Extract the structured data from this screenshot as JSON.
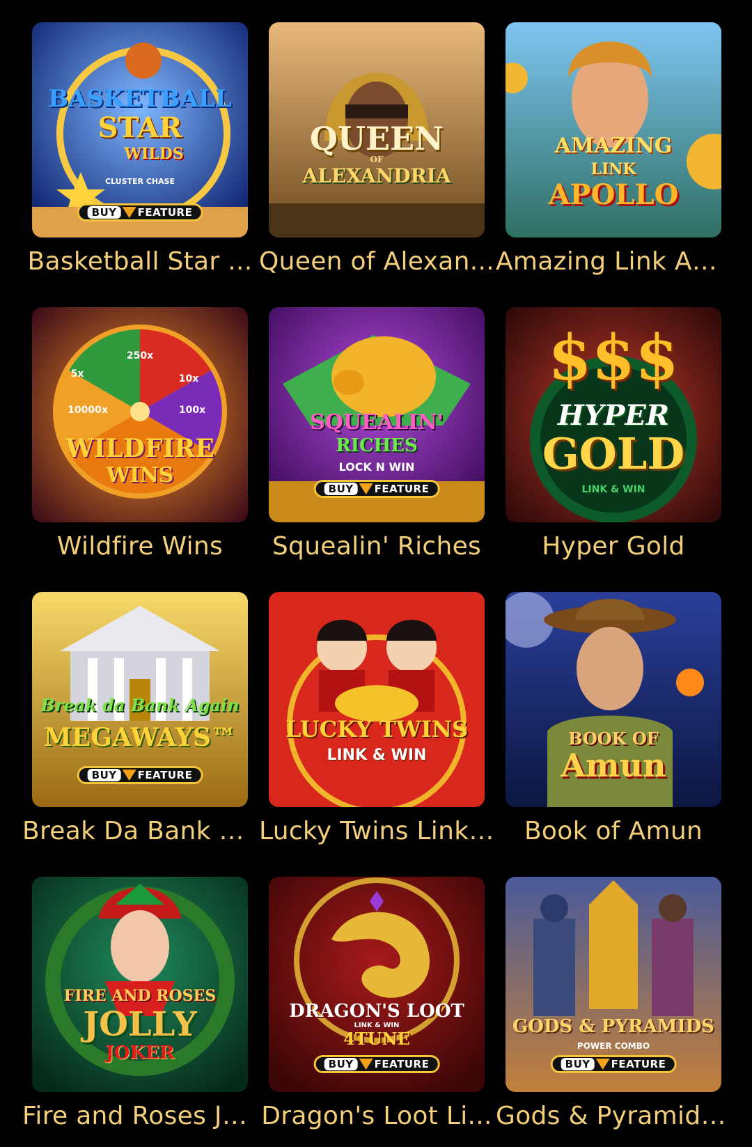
{
  "games": [
    {
      "title": "Basketball Star ...",
      "logo_lines": [
        "BASKETBALL",
        "STAR",
        "WILDS"
      ],
      "sub_text": "CLUSTER CHASE",
      "buy_feature": true
    },
    {
      "title": "Queen of Alexan...",
      "logo_lines": [
        "QUEEN",
        "OF",
        "ALEXANDRIA"
      ],
      "buy_feature": false
    },
    {
      "title": "Amazing Link Ap...",
      "logo_lines": [
        "AMAZING",
        "LINK",
        "APOLLO"
      ],
      "buy_feature": false
    },
    {
      "title": "Wildfire Wins",
      "logo_lines": [
        "WILDFIRE",
        "WINS"
      ],
      "wheel_labels": [
        "5x",
        "250x",
        "10x",
        "100x",
        "10000x"
      ],
      "buy_feature": false
    },
    {
      "title": "Squealin' Riches",
      "logo_lines": [
        "SQUEALIN'",
        "RICHES",
        "LOCK N WIN"
      ],
      "buy_feature": true
    },
    {
      "title": "Hyper Gold",
      "logo_lines": [
        "$$$",
        "HYPER",
        "GOLD",
        "LINK & WIN"
      ],
      "buy_feature": false
    },
    {
      "title": "Break Da Bank A...",
      "logo_lines": [
        "Break da Bank Again",
        "MEGAWAYS™"
      ],
      "buy_feature": true
    },
    {
      "title": "Lucky Twins Link ...",
      "logo_lines": [
        "LUCKY TWINS",
        "LINK & WIN"
      ],
      "buy_feature": false
    },
    {
      "title": "Book of Amun",
      "logo_lines": [
        "BOOK OF",
        "Amun"
      ],
      "buy_feature": false
    },
    {
      "title": "Fire and Roses Jo...",
      "logo_lines": [
        "FIRE AND ROSES",
        "JOLLY",
        "JOKER"
      ],
      "buy_feature": false
    },
    {
      "title": "Dragon's Loot Li...",
      "logo_lines": [
        "DRAGON'S LOOT",
        "LINK & WIN",
        "4TUNE"
      ],
      "buy_feature": true
    },
    {
      "title": "Gods & Pyramids...",
      "logo_lines": [
        "GODS & PYRAMIDS",
        "POWER COMBO"
      ],
      "buy_feature": true
    }
  ],
  "buy_label": "BUY",
  "feature_label": "FEATURE",
  "colors": {
    "background": "#000000",
    "title_text": "#f3cf7b",
    "logo_gold": "#f4c43a"
  }
}
